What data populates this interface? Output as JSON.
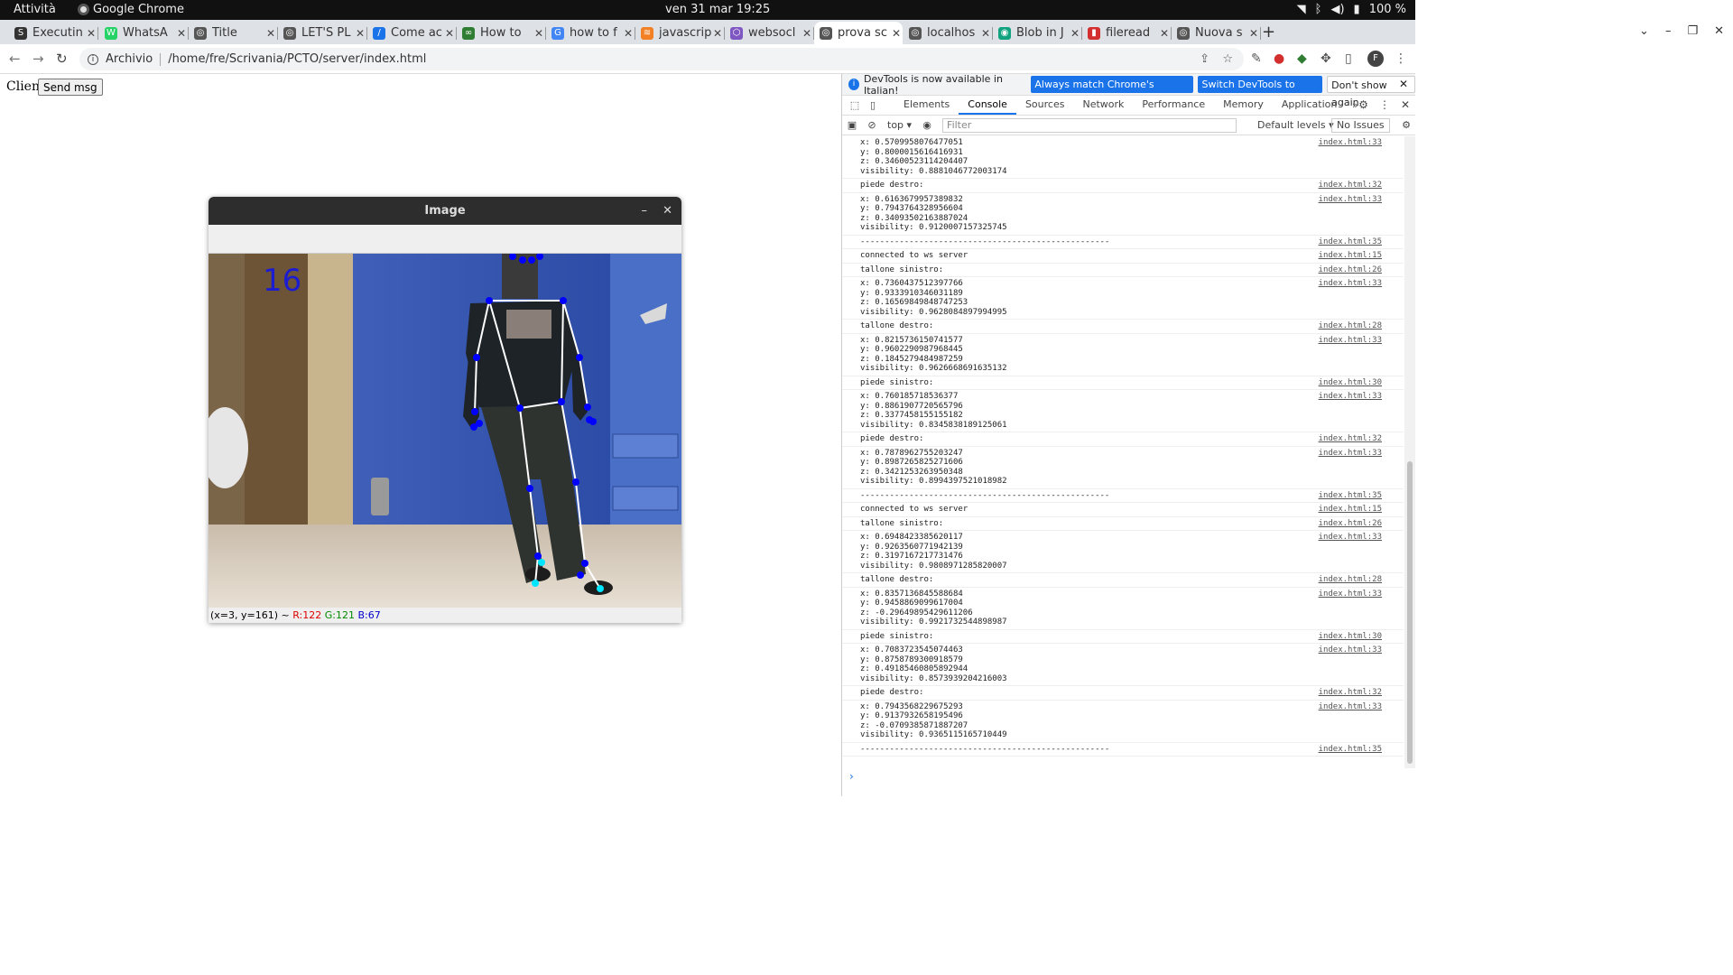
{
  "topbar": {
    "activities": "Attività",
    "app_name": "Google Chrome",
    "clock": "ven 31 mar  19:25",
    "battery": "100 %"
  },
  "tabs": [
    {
      "label": "Executin",
      "fav": "S",
      "color": "#333333"
    },
    {
      "label": "WhatsA",
      "fav": "W",
      "color": "#25d366"
    },
    {
      "label": "Title",
      "fav": "◎",
      "color": "#555555"
    },
    {
      "label": "LET'S PL",
      "fav": "◎",
      "color": "#555555"
    },
    {
      "label": "Come ac",
      "fav": "/",
      "color": "#1a73e8"
    },
    {
      "label": "How to",
      "fav": "∞",
      "color": "#2e7d32"
    },
    {
      "label": "how to f",
      "fav": "G",
      "color": "#4285f4"
    },
    {
      "label": "javascrip",
      "fav": "≋",
      "color": "#f48024"
    },
    {
      "label": "websocl",
      "fav": "⬡",
      "color": "#7e57c2"
    },
    {
      "label": "prova sc",
      "fav": "◎",
      "color": "#555555"
    },
    {
      "label": "localhos",
      "fav": "◎",
      "color": "#555555"
    },
    {
      "label": "Blob in J",
      "fav": "◉",
      "color": "#10a37f"
    },
    {
      "label": "fileread",
      "fav": "▮",
      "color": "#d32f2f"
    },
    {
      "label": "Nuova s",
      "fav": "◎",
      "color": "#555555"
    }
  ],
  "active_tab_index": 9,
  "address": {
    "scheme": "Archivio",
    "url": "/home/fre/Scrivania/PCTO/server/index.html"
  },
  "page": {
    "client_label": "Client",
    "send_button": "Send msg"
  },
  "cv_window": {
    "title": "Image",
    "frame_counter": "16",
    "status_coords": "(x=3, y=161) ~ ",
    "status_r": "R:122",
    "status_g": "G:121",
    "status_b": "B:67"
  },
  "devtools": {
    "info_text": "DevTools is now available in Italian!",
    "btn_match": "Always match Chrome's language",
    "btn_switch": "Switch DevTools to Italian",
    "btn_dismiss": "Don't show again",
    "tabs": [
      "Elements",
      "Console",
      "Sources",
      "Network",
      "Performance",
      "Memory",
      "Application"
    ],
    "active_tab": "Console",
    "context": "top ▾",
    "filter_placeholder": "Filter",
    "levels": "Default levels ▾",
    "issues": "No Issues",
    "console": [
      {
        "lines": [
          "x: 0.5709958076477051",
          "y: 0.8000015616416931",
          "z: 0.34600523114204407",
          "visibility: 0.8881046772003174"
        ],
        "src": "index.html:33"
      },
      {
        "lines": [
          "piede destro:"
        ],
        "src": "index.html:32"
      },
      {
        "lines": [
          "x: 0.6163679957389832",
          "y: 0.7943764328956604",
          "z: 0.34093502163887024",
          "visibility: 0.9120007157325745"
        ],
        "src": "index.html:33"
      },
      {
        "lines": [
          "---------------------------------------------------"
        ],
        "src": "index.html:35"
      },
      {
        "lines": [
          "connected to ws server"
        ],
        "src": "index.html:15"
      },
      {
        "lines": [
          "tallone sinistro:"
        ],
        "src": "index.html:26"
      },
      {
        "lines": [
          "x: 0.7360437512397766",
          "y: 0.9333910346031189",
          "z: 0.16569849848747253",
          "visibility: 0.9628084897994995"
        ],
        "src": "index.html:33"
      },
      {
        "lines": [
          "tallone destro:"
        ],
        "src": "index.html:28"
      },
      {
        "lines": [
          "x: 0.8215736150741577",
          "y: 0.9602290987968445",
          "z: 0.1845279484987259",
          "visibility: 0.9626668691635132"
        ],
        "src": "index.html:33"
      },
      {
        "lines": [
          "piede sinistro:"
        ],
        "src": "index.html:30"
      },
      {
        "lines": [
          "x: 0.760185718536377",
          "y: 0.8861907720565796",
          "z: 0.3377458155155182",
          "visibility: 0.8345838189125061"
        ],
        "src": "index.html:33"
      },
      {
        "lines": [
          "piede destro:"
        ],
        "src": "index.html:32"
      },
      {
        "lines": [
          "x: 0.7878962755203247",
          "y: 0.8987265825271606",
          "z: 0.3421253263950348",
          "visibility: 0.8994397521018982"
        ],
        "src": "index.html:33"
      },
      {
        "lines": [
          "---------------------------------------------------"
        ],
        "src": "index.html:35"
      },
      {
        "lines": [
          "connected to ws server"
        ],
        "src": "index.html:15"
      },
      {
        "lines": [
          "tallone sinistro:"
        ],
        "src": "index.html:26"
      },
      {
        "lines": [
          "x: 0.6948423385620117",
          "y: 0.9263560771942139",
          "z: 0.3197167217731476",
          "visibility: 0.9808971285820007"
        ],
        "src": "index.html:33"
      },
      {
        "lines": [
          "tallone destro:"
        ],
        "src": "index.html:28"
      },
      {
        "lines": [
          "x: 0.8357136845588684",
          "y: 0.9458869099617004",
          "z: -0.29649895429611206",
          "visibility: 0.9921732544898987"
        ],
        "src": "index.html:33"
      },
      {
        "lines": [
          "piede sinistro:"
        ],
        "src": "index.html:30"
      },
      {
        "lines": [
          "x: 0.7083723545074463",
          "y: 0.8758789300918579",
          "z: 0.49185460805892944",
          "visibility: 0.8573939204216003"
        ],
        "src": "index.html:33"
      },
      {
        "lines": [
          "piede destro:"
        ],
        "src": "index.html:32"
      },
      {
        "lines": [
          "x: 0.7943568229675293",
          "y: 0.9137932658195496",
          "z: -0.0709385871887207",
          "visibility: 0.9365115165710449"
        ],
        "src": "index.html:33"
      },
      {
        "lines": [
          "---------------------------------------------------"
        ],
        "src": "index.html:35"
      }
    ]
  }
}
